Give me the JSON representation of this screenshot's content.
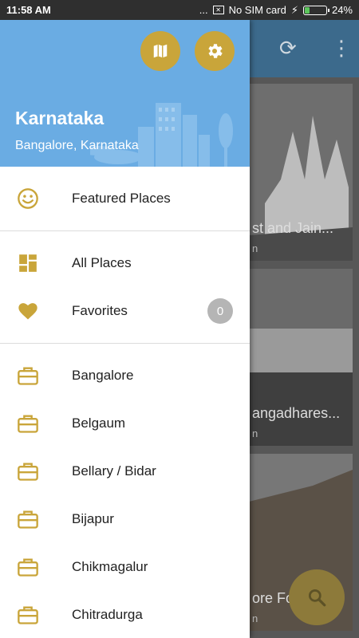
{
  "status_bar": {
    "time": "11:58 AM",
    "dots": "...",
    "sim_text": "No SIM card",
    "battery_percent": "24%",
    "battery_level": 0.24
  },
  "drawer": {
    "title": "Karnataka",
    "subtitle": "Bangalore, Karnataka",
    "header_buttons": [
      {
        "icon": "map-icon"
      },
      {
        "icon": "settings-icon"
      }
    ],
    "featured": {
      "label": "Featured Places",
      "icon": "smiley-icon"
    },
    "all_places": {
      "label": "All Places",
      "icon": "dashboard-icon"
    },
    "favorites": {
      "label": "Favorites",
      "icon": "heart-icon",
      "count": "0"
    },
    "cities": [
      {
        "label": "Bangalore",
        "icon": "briefcase-icon"
      },
      {
        "label": "Belgaum",
        "icon": "briefcase-icon"
      },
      {
        "label": "Bellary / Bidar",
        "icon": "briefcase-icon"
      },
      {
        "label": "Bijapur",
        "icon": "briefcase-icon"
      },
      {
        "label": "Chikmagalur",
        "icon": "briefcase-icon"
      },
      {
        "label": "Chitradurga",
        "icon": "briefcase-icon"
      }
    ]
  },
  "background": {
    "cards": [
      {
        "title": "st and Jain...",
        "sub": "n"
      },
      {
        "title": "angadhares...",
        "sub": "n"
      },
      {
        "title": "ore Fo",
        "sub": "n"
      }
    ]
  },
  "colors": {
    "accent": "#c9a53a",
    "header_bg": "#6aace3",
    "badge": "#b5b5b5"
  }
}
